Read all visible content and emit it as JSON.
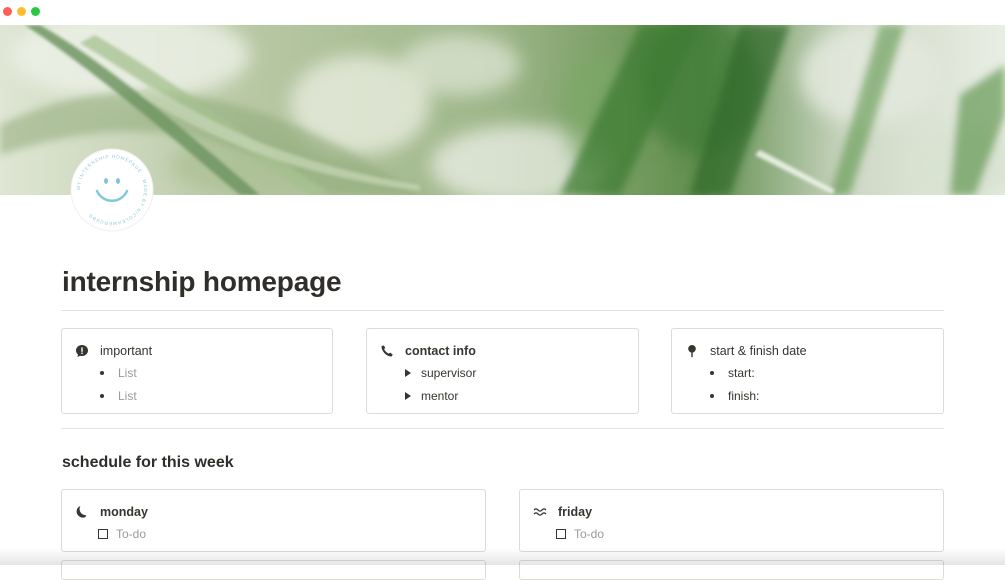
{
  "page": {
    "title": "internship homepage",
    "badge_ring_text": "MY INTERNSHIP HOMEPAGE · MADE BY NICOLEAMERUSBG"
  },
  "top_cards": [
    {
      "title": "important",
      "icon": "exclamation-bubble-icon",
      "rows": [
        "List",
        "List"
      ]
    },
    {
      "title": "contact info",
      "icon": "phone-icon",
      "rows": [
        "supervisor",
        "mentor"
      ]
    },
    {
      "title": "start & finish date",
      "icon": "pin-icon",
      "rows": [
        "start:",
        "finish:"
      ]
    }
  ],
  "schedule": {
    "title": "schedule for this week",
    "days": [
      {
        "name": "monday",
        "icon": "moon-icon",
        "todo": "To-do"
      },
      {
        "name": "friday",
        "icon": "waves-icon",
        "todo": "To-do"
      }
    ]
  },
  "colors": {
    "text": "#37352f",
    "muted": "#9b9a97",
    "border": "#dedcd8",
    "smiley": "#7fc8d8"
  }
}
